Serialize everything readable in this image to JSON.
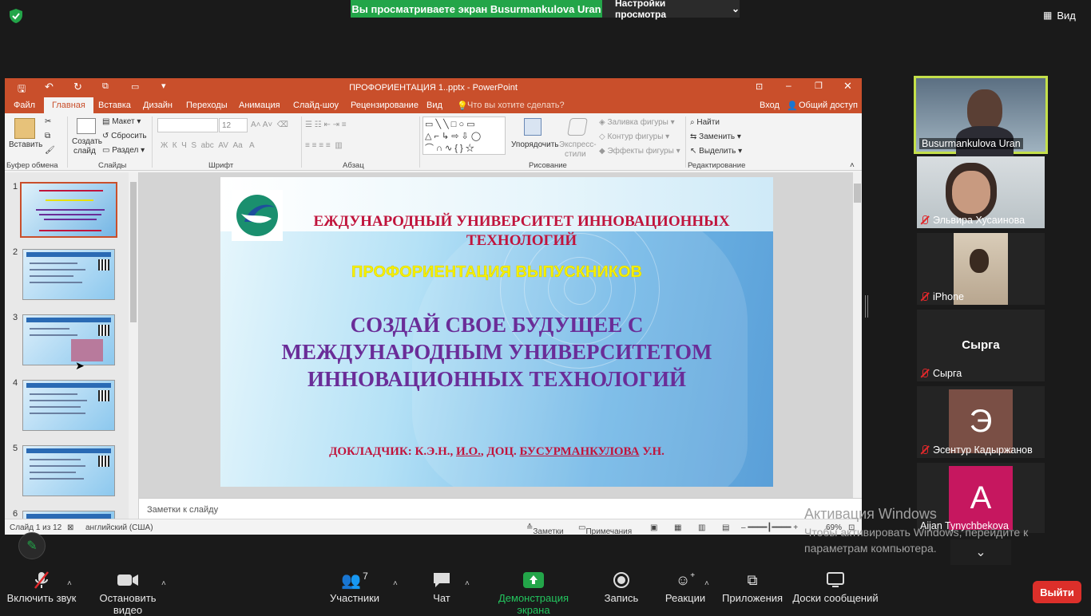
{
  "zoom": {
    "share_banner": "Вы просматриваете экран Busurmankulova Uran",
    "view_settings": "Настройки просмотра",
    "view_button": "Вид"
  },
  "ppt": {
    "title": "ПРОФОРИЕНТАЦИЯ 1..pptx - PowerPoint",
    "menu": {
      "file": "Файл",
      "home": "Главная",
      "insert": "Вставка",
      "design": "Дизайн",
      "transitions": "Переходы",
      "animation": "Анимация",
      "slideshow": "Слайд-шоу",
      "review": "Рецензирование",
      "view": "Вид",
      "tell_me": "Что вы хотите сделать?",
      "signin": "Вход",
      "share": "Общий доступ"
    },
    "ribbon": {
      "paste": "Вставить",
      "clipboard": "Буфер обмена",
      "new_slide": "Создать",
      "new_slide2": "слайд",
      "layout": "Макет",
      "reset": "Сбросить",
      "section": "Раздел",
      "slides": "Слайды",
      "font_size": "12",
      "font": "Шрифт",
      "paragraph": "Абзац",
      "arrange": "Упорядочить",
      "quick_styles": "Экспресс-",
      "quick_styles2": "стили",
      "shape_fill": "Заливка фигуры",
      "shape_outline": "Контур фигуры",
      "shape_effects": "Эффекты фигуры",
      "drawing": "Рисование",
      "find": "Найти",
      "replace": "Заменить",
      "select": "Выделить",
      "editing": "Редактирование"
    },
    "slide": {
      "title": "ЕЖДУНАРОДНЫЙ УНИВЕРСИТЕТ ИННОВАЦИОННЫХ ТЕХНОЛОГИЙ",
      "subtitle": "ПРОФОРИЕНТАЦИЯ ВЫПУСКНИКОВ",
      "main_line1": "СОЗДАЙ СВОЕ БУДУЩЕЕ С",
      "main_line2": "МЕЖДУНАРОДНЫМ УНИВЕРСИТЕТОМ",
      "main_line3": "ИННОВАЦИОННЫХ ТЕХНОЛОГИЙ",
      "speaker_a": "ДОКЛАДЧИК: К.Э.Н., ",
      "speaker_b": "И.О.",
      "speaker_c": ", ДОЦ. ",
      "speaker_d": "БУСУРМАНКУЛОВА",
      "speaker_e": " У.Н."
    },
    "thumbs": [
      "1",
      "2",
      "3",
      "4",
      "5",
      "6"
    ],
    "notes": "Заметки к слайду",
    "status": {
      "slide": "Слайд 1 из 12",
      "lang": "английский (США)",
      "notes": "Заметки",
      "comments": "Примечания",
      "zoom": "69%"
    }
  },
  "participants": [
    {
      "name": "Busurmankulova Uran",
      "muted": false
    },
    {
      "name": "Эльвира Хусаинова",
      "muted": true
    },
    {
      "name": "iPhone",
      "muted": true
    },
    {
      "name": "Сырга",
      "muted": true,
      "label": "Сырга"
    },
    {
      "name": "Эсентур Кадыржанов",
      "muted": true,
      "initial": "Э"
    },
    {
      "name": "Aijan Tynychbekova",
      "muted": false,
      "initial": "A"
    }
  ],
  "activation": {
    "line1": "Активация Windows",
    "line2": "Чтобы активировать Windows, перейдите к",
    "line3": "параметрам компьютера."
  },
  "toolbar": {
    "unmute": "Включить звук",
    "stop_video": "Остановить видео",
    "participants": "Участники",
    "participants_count": "7",
    "chat": "Чат",
    "share_screen": "Демонстрация экрана",
    "record": "Запись",
    "reactions": "Реакции",
    "apps": "Приложения",
    "whiteboards": "Доски сообщений",
    "leave": "Выйти"
  },
  "colors": {
    "ppt_accent": "#c94f2b",
    "share_green": "#23a549",
    "leave_red": "#dc2f2a",
    "active_speaker": "#c4e04a"
  }
}
